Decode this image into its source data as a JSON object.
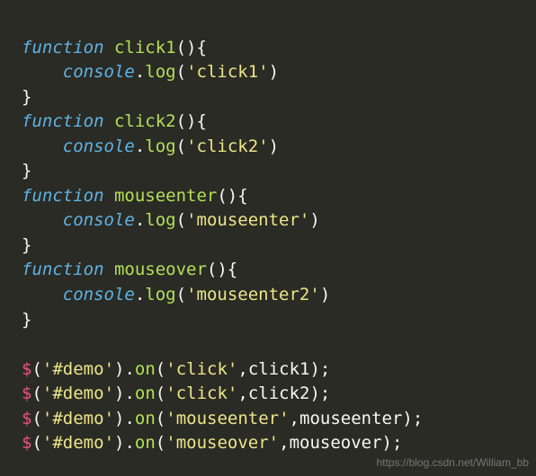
{
  "code": {
    "fn1_name": "click1",
    "fn1_log": "click1",
    "fn2_name": "click2",
    "fn2_log": "click2",
    "fn3_name": "mouseenter",
    "fn3_log": "mouseenter",
    "fn4_name": "mouseover",
    "fn4_log": "mouseenter2",
    "selector": "#demo",
    "evt1": "click",
    "evt2": "click",
    "evt3": "mouseenter",
    "evt4": "mouseover",
    "h1": "click1",
    "h2": "click2",
    "h3": "mouseenter",
    "h4": "mouseover"
  },
  "watermark": "https://blog.csdn.net/William_bb"
}
